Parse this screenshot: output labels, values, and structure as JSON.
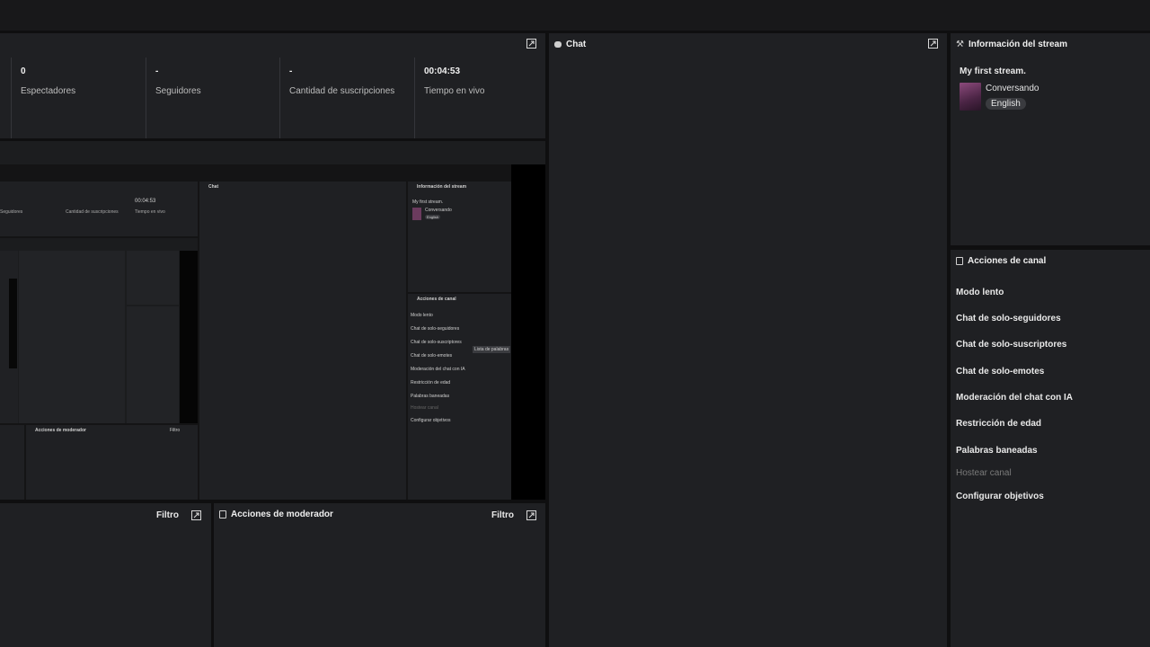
{
  "stats": [
    {
      "value": "0",
      "label": "Espectadores"
    },
    {
      "value": "-",
      "label": "Seguidores"
    },
    {
      "value": "-",
      "label": "Cantidad de suscripciones"
    },
    {
      "value": "00:04:53",
      "label": "Tiempo en vivo"
    }
  ],
  "chat": {
    "title": "Chat"
  },
  "stream_info": {
    "title": "Información del stream",
    "stream_title": "My first stream.",
    "category": "Conversando",
    "language": "English"
  },
  "channel_actions": {
    "title": "Acciones de canal",
    "items": [
      {
        "label": "Modo lento",
        "disabled": false
      },
      {
        "label": "Chat de solo-seguidores",
        "disabled": false
      },
      {
        "label": "Chat de solo-suscriptores",
        "disabled": false
      },
      {
        "label": "Chat de solo-emotes",
        "disabled": false
      },
      {
        "label": "Moderación del chat con IA",
        "disabled": false
      },
      {
        "label": "Restricción de edad",
        "disabled": false
      },
      {
        "label": "Palabras baneadas",
        "disabled": false
      },
      {
        "label": "Hostear canal",
        "disabled": true
      },
      {
        "label": "Configurar objetivos",
        "disabled": false
      }
    ]
  },
  "activity": {
    "filter_label": "Filtro"
  },
  "mod_actions": {
    "title": "Acciones de moderador",
    "filter_label": "Filtro"
  },
  "preview": {
    "stat_value": "00:04:53",
    "stat_labels": [
      "Seguidores",
      "Cantidad de suscripciones",
      "Tiempo en vivo"
    ],
    "chat_title": "Chat",
    "info_title": "Información del stream",
    "stream_title": "My first stream.",
    "category": "Conversando",
    "language": "English",
    "actions_title": "Acciones de canal",
    "action_items": [
      "Modo lento",
      "Chat de solo-seguidores",
      "Chat de solo-suscriptores",
      "Chat de solo-emotes",
      "Moderación del chat con IA",
      "Restricción de edad",
      "Palabras baneadas",
      "Hostear canal",
      "Configurar objetivos"
    ],
    "tooltip": "Lista de palabras",
    "mod_title": "Acciones de moderador",
    "filter_label": "Filtro"
  },
  "colors": {
    "background": "#0f0f10",
    "panel": "#1f2023",
    "text": "#e6e6e6",
    "muted": "#bdbdbd",
    "disabled": "#7a7a7a",
    "badge": "#3a3b3f"
  }
}
